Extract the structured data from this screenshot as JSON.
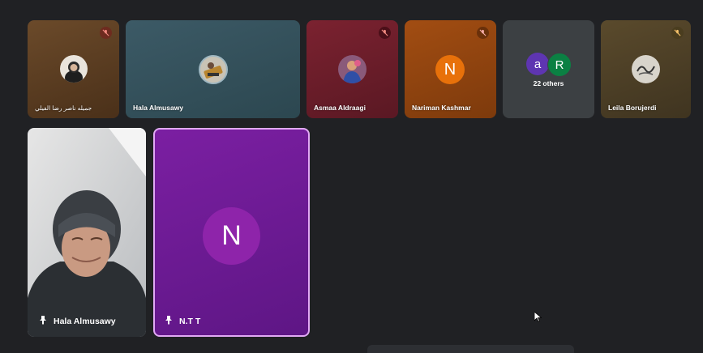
{
  "participants_top": [
    {
      "name": "جميله ناصر رضا الفيلي",
      "muted": true
    },
    {
      "name": "Hala Almusawy",
      "muted": false
    },
    {
      "name": "Asmaa Aldraagi",
      "muted": true
    },
    {
      "name": "Nariman Kashmar",
      "muted": true,
      "initial": "N"
    },
    {
      "name": "22 others",
      "initials": [
        "a",
        "R"
      ]
    },
    {
      "name": "Leila Borujerdi",
      "muted": true
    }
  ],
  "participants_bottom": [
    {
      "name": "Hala Almusawy"
    },
    {
      "name": "N.T T",
      "initial": "N"
    }
  ],
  "colors": {
    "background": "#202124",
    "muted_badge": "#6e2b1f",
    "purple_tile": "#7b1fa2",
    "purple_border": "#e1a9f4",
    "orange_avatar": "#e8710a",
    "others_a": "#5e35b1",
    "others_r": "#0b8043"
  }
}
